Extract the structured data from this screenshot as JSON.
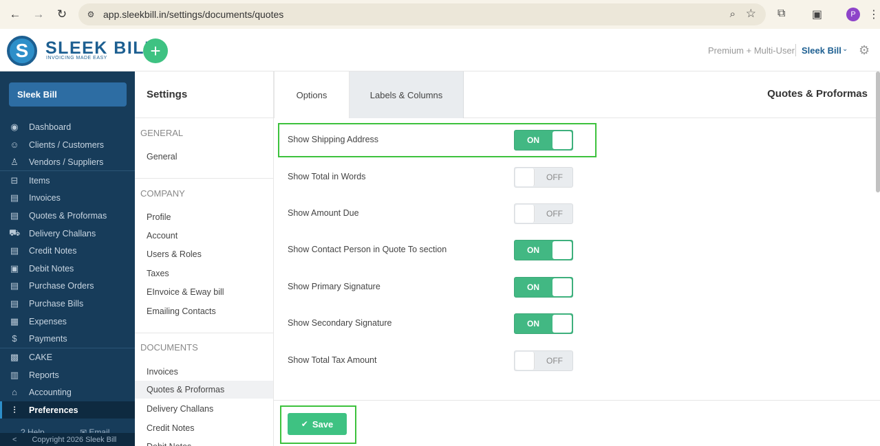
{
  "browser": {
    "url": "app.sleekbill.in/settings/documents/quotes",
    "profile_initial": "P"
  },
  "header": {
    "logo_text": "SLEEK BILL",
    "logo_tagline": "INVOICING MADE EASY",
    "plan": "Premium + Multi-User",
    "user": "Sleek Bill"
  },
  "sidebar": {
    "org": "Sleek Bill",
    "items": [
      {
        "label": "Dashboard",
        "icon": "eye-icon"
      },
      {
        "label": "Clients / Customers",
        "icon": "users-icon"
      },
      {
        "label": "Vendors / Suppliers",
        "icon": "user-icon"
      },
      {
        "label": "Items",
        "icon": "basket-icon"
      },
      {
        "label": "Invoices",
        "icon": "document-icon"
      },
      {
        "label": "Quotes & Proformas",
        "icon": "document-icon"
      },
      {
        "label": "Delivery Challans",
        "icon": "truck-icon"
      },
      {
        "label": "Credit Notes",
        "icon": "document-icon"
      },
      {
        "label": "Debit Notes",
        "icon": "dollar-doc-icon"
      },
      {
        "label": "Purchase Orders",
        "icon": "document-icon"
      },
      {
        "label": "Purchase Bills",
        "icon": "document-icon"
      },
      {
        "label": "Expenses",
        "icon": "calculator-icon"
      },
      {
        "label": "Payments",
        "icon": "dollar-icon"
      },
      {
        "label": "CAKE",
        "icon": "cake-icon"
      },
      {
        "label": "Reports",
        "icon": "chart-icon"
      },
      {
        "label": "Accounting",
        "icon": "bank-icon"
      },
      {
        "label": "Preferences",
        "icon": "sliders-icon"
      }
    ],
    "help": "Help",
    "email": "Email",
    "copyright": "Copyright 2026 Sleek Bill"
  },
  "settings": {
    "title": "Settings",
    "groups": {
      "general": "GENERAL",
      "company": "COMPANY",
      "documents": "DOCUMENTS"
    },
    "general_links": [
      "General"
    ],
    "company_links": [
      "Profile",
      "Account",
      "Users & Roles",
      "Taxes",
      "EInvoice & Eway bill",
      "Emailing Contacts"
    ],
    "document_links": [
      "Invoices",
      "Quotes & Proformas",
      "Delivery Challans",
      "Credit Notes",
      "Debit Notes"
    ]
  },
  "main": {
    "tabs": [
      "Options",
      "Labels & Columns"
    ],
    "title": "Quotes & Proformas",
    "options": [
      {
        "label": "Show Shipping Address",
        "state": "ON"
      },
      {
        "label": "Show Total in Words",
        "state": "OFF"
      },
      {
        "label": "Show Amount Due",
        "state": "OFF"
      },
      {
        "label": "Show Contact Person in Quote To section",
        "state": "ON"
      },
      {
        "label": "Show Primary Signature",
        "state": "ON"
      },
      {
        "label": "Show Secondary Signature",
        "state": "ON"
      },
      {
        "label": "Show Total Tax Amount",
        "state": "OFF"
      }
    ],
    "save_label": "Save"
  },
  "colors": {
    "accent_green": "#42b883",
    "sidebar_bg": "#173c5a",
    "brand_blue": "#1d5f91",
    "highlight": "#3cc13c"
  }
}
